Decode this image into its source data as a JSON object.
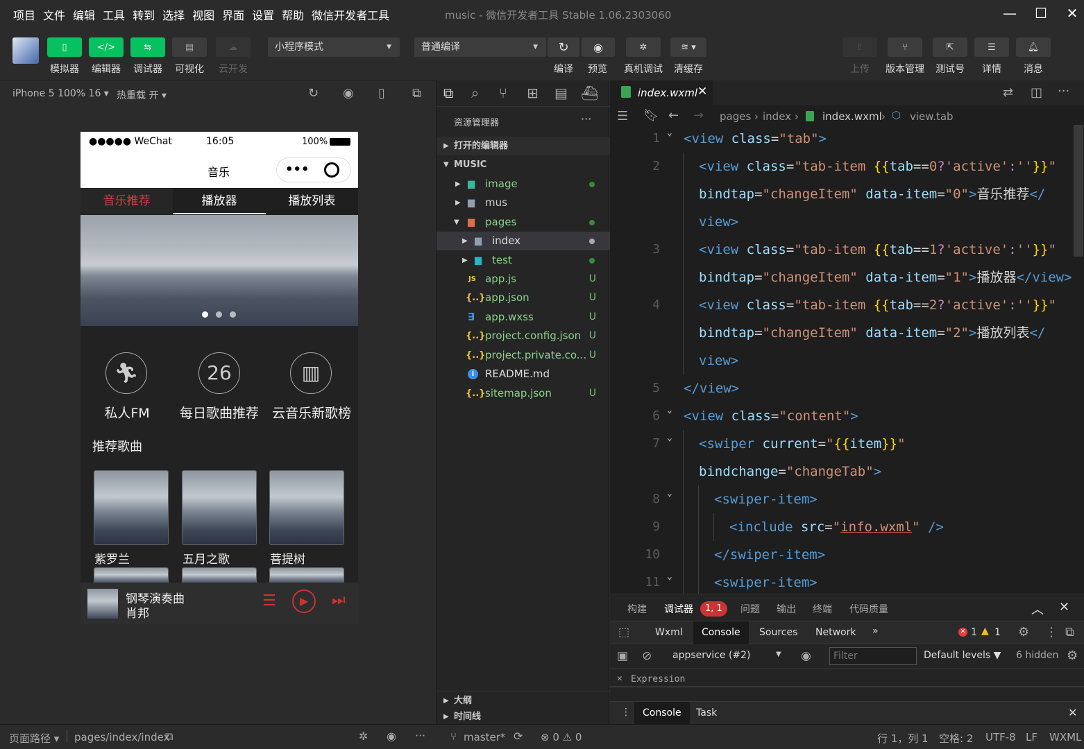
{
  "menu": [
    "项目",
    "文件",
    "编辑",
    "工具",
    "转到",
    "选择",
    "视图",
    "界面",
    "设置",
    "帮助",
    "微信开发者工具"
  ],
  "window_title": "music - 微信开发者工具 Stable 1.06.2303060",
  "toolbar": {
    "left_buttons": [
      {
        "label": "模拟器",
        "icon": "phone-icon"
      },
      {
        "label": "编辑器",
        "icon": "code-icon"
      },
      {
        "label": "调试器",
        "icon": "sliders-icon"
      },
      {
        "label": "可视化",
        "icon": "layout-icon"
      },
      {
        "label": "云开发",
        "icon": "cloud-icon"
      }
    ],
    "mode_select": "小程序模式",
    "compile_select": "普通编译",
    "mid_buttons": [
      {
        "label": "编译",
        "icon": "refresh-icon"
      },
      {
        "label": "预览",
        "icon": "eye-icon"
      },
      {
        "label": "真机调试",
        "icon": "bug-icon"
      },
      {
        "label": "清缓存",
        "icon": "layers-icon"
      }
    ],
    "right_buttons": [
      {
        "label": "上传",
        "icon": "upload-icon"
      },
      {
        "label": "版本管理",
        "icon": "branch-icon"
      },
      {
        "label": "测试号",
        "icon": "external-icon"
      },
      {
        "label": "详情",
        "icon": "menu-icon"
      },
      {
        "label": "消息",
        "icon": "bell-icon"
      }
    ]
  },
  "simulator_bar": {
    "device": "iPhone 5 100% 16 ▾",
    "hot_reload": "热重载 开 ▾"
  },
  "phone": {
    "carrier": "●●●●● WeChat",
    "time": "16:05",
    "battery": "100%",
    "nav_title": "音乐",
    "tabs": [
      "音乐推荐",
      "播放器",
      "播放列表"
    ],
    "features": [
      {
        "label": "私人FM",
        "icon": "running-icon"
      },
      {
        "label": "每日歌曲推荐",
        "icon_text": "26"
      },
      {
        "label": "云音乐新歌榜",
        "icon": "bar-chart-icon"
      }
    ],
    "section_title": "推荐歌曲",
    "songs": [
      "紫罗兰",
      "五月之歌",
      "菩提树"
    ],
    "player": {
      "title": "钢琴演奏曲",
      "artist": "肖邦"
    }
  },
  "explorer": {
    "title": "资源管理器",
    "open_editors": "打开的编辑器",
    "project": "MUSIC",
    "items": [
      {
        "name": "image",
        "badge": "",
        "dot": true
      },
      {
        "name": "mus",
        "badge": "",
        "dot": false
      },
      {
        "name": "pages",
        "badge": "",
        "dot": true
      },
      {
        "name": "index",
        "badge": "",
        "dot": true
      },
      {
        "name": "test",
        "badge": "",
        "dot": true
      },
      {
        "name": "app.js",
        "badge": "U",
        "dot": false
      },
      {
        "name": "app.json",
        "badge": "U",
        "dot": false
      },
      {
        "name": "app.wxss",
        "badge": "U",
        "dot": false
      },
      {
        "name": "project.config.json",
        "badge": "U",
        "dot": false
      },
      {
        "name": "project.private.co...",
        "badge": "U",
        "dot": false
      },
      {
        "name": "README.md",
        "badge": "",
        "dot": false
      },
      {
        "name": "sitemap.json",
        "badge": "U",
        "dot": false
      }
    ],
    "outline": "大纲",
    "timeline": "时间线"
  },
  "editor": {
    "tab": "index.wxml",
    "breadcrumb": [
      "pages",
      "index",
      "index.wxml",
      "view.tab"
    ],
    "line_numbers": [
      "1",
      "2",
      "",
      "",
      "3",
      "",
      "4",
      "",
      "5",
      "6",
      "7",
      "",
      "8",
      "9",
      "10",
      "11"
    ]
  },
  "devtools": {
    "top_tabs": [
      "构建",
      "调试器",
      "问题",
      "输出",
      "终端",
      "代码质量"
    ],
    "badge": "1, 1",
    "panel_tabs": [
      "Wxml",
      "Console",
      "Sources",
      "Network"
    ],
    "errors": "1",
    "warnings": "1",
    "context": "appservice (#2)",
    "filter_placeholder": "Filter",
    "levels": "Default levels ▼",
    "hidden": "6 hidden",
    "expression": "Expression",
    "drawer_tabs": [
      "Console",
      "Task"
    ]
  },
  "footer": {
    "page_path_label": "页面路径 ▾",
    "page_path": "pages/index/index",
    "branch": "master*",
    "problems": "⊗ 0 ⚠ 0",
    "position": "行 1，列 1",
    "spaces": "空格: 2",
    "encoding": "UTF-8",
    "eol": "LF",
    "lang": "WXML"
  }
}
